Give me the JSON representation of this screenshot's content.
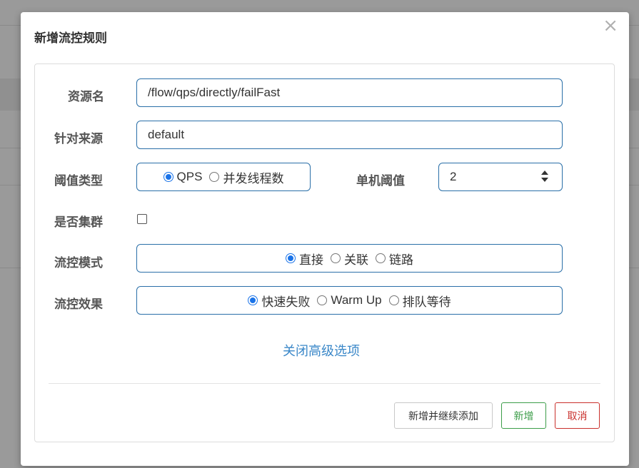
{
  "dialog": {
    "title": "新增流控规则",
    "close_glyph": "×"
  },
  "form": {
    "resource": {
      "label": "资源名",
      "value": "/flow/qps/directly/failFast"
    },
    "limit_app": {
      "label": "针对来源",
      "value": "default"
    },
    "grade": {
      "label": "阈值类型",
      "options": [
        {
          "label": "QPS",
          "checked": true
        },
        {
          "label": "并发线程数",
          "checked": false
        }
      ]
    },
    "count": {
      "label": "单机阈值",
      "value": "2"
    },
    "cluster": {
      "label": "是否集群",
      "checked": false
    },
    "strategy": {
      "label": "流控模式",
      "options": [
        {
          "label": "直接",
          "checked": true
        },
        {
          "label": "关联",
          "checked": false
        },
        {
          "label": "链路",
          "checked": false
        }
      ]
    },
    "control_behavior": {
      "label": "流控效果",
      "options": [
        {
          "label": "快速失败",
          "checked": true
        },
        {
          "label": "Warm Up",
          "checked": false
        },
        {
          "label": "排队等待",
          "checked": false
        }
      ]
    },
    "advanced_toggle": "关闭高级选项"
  },
  "footer": {
    "add_continue": "新增并继续添加",
    "add": "新增",
    "cancel": "取消"
  },
  "colors": {
    "accent": "#2a6fa8",
    "link": "#3a87c8",
    "success": "#3c9d49",
    "danger": "#c9302c"
  }
}
